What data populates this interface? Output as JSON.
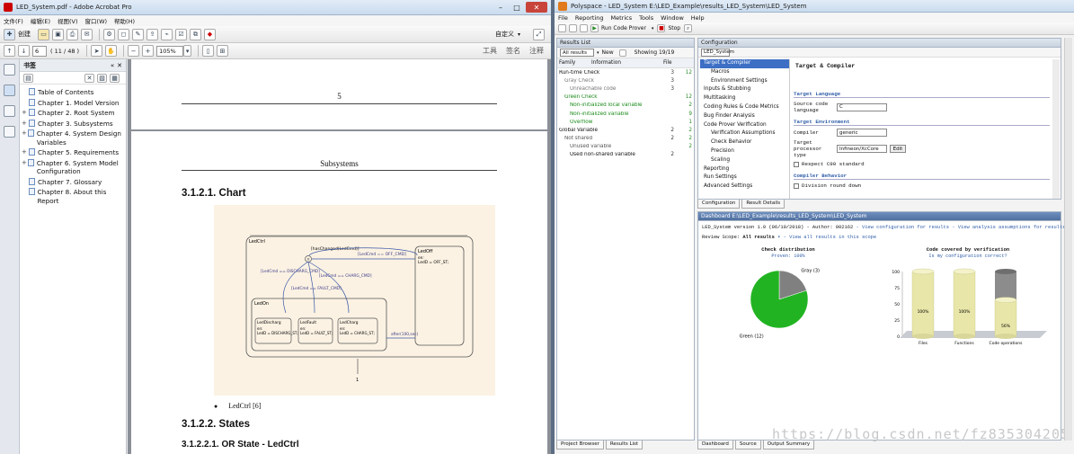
{
  "acrobat": {
    "title": "LED_System.pdf - Adobe Acrobat Pro",
    "menu": [
      "文件(F)",
      "编辑(E)",
      "视图(V)",
      "窗口(W)",
      "帮助(H)"
    ],
    "create_label": "创建",
    "customize_label": "自定义",
    "page_input": "6",
    "page_count": "( 11 / 48 )",
    "zoom": "105%",
    "right_tools": [
      "工具",
      "签名",
      "注释"
    ],
    "bookmarks_title": "书签",
    "bookmarks": [
      {
        "label": "Table of Contents",
        "expand": ""
      },
      {
        "label": "Chapter 1. Model Version",
        "expand": ""
      },
      {
        "label": "Chapter 2. Root System",
        "expand": "+"
      },
      {
        "label": "Chapter 3. Subsystems",
        "expand": "+"
      },
      {
        "label": "Chapter 4. System Design Variables",
        "expand": "+"
      },
      {
        "label": "Chapter 5. Requirements",
        "expand": "+"
      },
      {
        "label": "Chapter 6. System Model Configuration",
        "expand": "+"
      },
      {
        "label": "Chapter 7. Glossary",
        "expand": ""
      },
      {
        "label": "Chapter 8. About this Report",
        "expand": ""
      }
    ],
    "doc": {
      "page_number": "5",
      "running_header": "Subsystems",
      "h_chart": "3.1.2.1. Chart",
      "bullet_text": "LedCtrl [6]",
      "h_states": "3.1.2.2. States",
      "h_or_state": "3.1.2.2.1. OR State - LedCtrl"
    },
    "diagram": {
      "outer": "LedCtrl",
      "top_event": "[hasChanged(LedCmd)]",
      "to_off": "[LedCmd == OFF_CMD]",
      "off_state": "LedOff",
      "off_entry": "en:\nLedD = OFF_ST;",
      "disch": "[LedCmd == DISCHARG_CMD]",
      "charg": "[LedCmd == CHARG_CMD]",
      "fault": "[LedCmd == FAULT_CMD]",
      "on_state": "LedOn",
      "sub1": "LedDischarg",
      "sub1_entry": "en:\nLedD = DISCHARG_ST;",
      "sub2": "LedFault",
      "sub2_entry": "en:\nLedD = FAULT_ST;",
      "sub3": "LedCharg",
      "sub3_entry": "en:\nLedD = CHARG_ST;",
      "after": "after(100,sec)",
      "default_num": "1"
    }
  },
  "polyspace": {
    "title": "Polyspace - LED_System E:\\LED_Example\\results_LED_System\\LED_System",
    "menu": [
      "File",
      "Reporting",
      "Metrics",
      "Tools",
      "Window",
      "Help"
    ],
    "run_label": "Run Code Prover",
    "stop_label": "Stop",
    "results": {
      "title": "Results List",
      "filter": "All results",
      "new_label": "New",
      "showing": "Showing 19/19",
      "col_family": "Family",
      "col_info": "Information",
      "col_file": "File",
      "rows": [
        {
          "label": "Run-time Check",
          "indent": 0,
          "a": "3",
          "b": "12",
          "color": "#111"
        },
        {
          "label": "Gray Check",
          "indent": 1,
          "a": "3",
          "b": "",
          "color": "#777"
        },
        {
          "label": "Unreachable code",
          "indent": 2,
          "a": "3",
          "b": "",
          "color": "#777"
        },
        {
          "label": "Green Check",
          "indent": 1,
          "a": "",
          "b": "12",
          "color": "#1a8a1a"
        },
        {
          "label": "Non-initialized local variable",
          "indent": 2,
          "a": "",
          "b": "2",
          "color": "#1a8a1a"
        },
        {
          "label": "Non-initialized variable",
          "indent": 2,
          "a": "",
          "b": "9",
          "color": "#1a8a1a"
        },
        {
          "label": "Overflow",
          "indent": 2,
          "a": "",
          "b": "1",
          "color": "#1a8a1a"
        },
        {
          "label": "Global Variable",
          "indent": 0,
          "a": "2",
          "b": "2",
          "color": "#111"
        },
        {
          "label": "Not shared",
          "indent": 1,
          "a": "2",
          "b": "2",
          "color": "#555"
        },
        {
          "label": "Unused variable",
          "indent": 2,
          "a": "",
          "b": "2",
          "color": "#555"
        },
        {
          "label": "Used non-shared variable",
          "indent": 2,
          "a": "2",
          "b": "",
          "color": "#111"
        }
      ]
    },
    "config": {
      "title": "Configuration",
      "project": "LED_System",
      "tree": [
        {
          "label": "Target & Compiler",
          "indent": 0,
          "selected": true
        },
        {
          "label": "Macros",
          "indent": 1
        },
        {
          "label": "Environment Settings",
          "indent": 1
        },
        {
          "label": "Inputs & Stubbing",
          "indent": 0
        },
        {
          "label": "Multitasking",
          "indent": 0
        },
        {
          "label": "Coding Rules & Code Metrics",
          "indent": 0
        },
        {
          "label": "Bug Finder Analysis",
          "indent": 0
        },
        {
          "label": "Code Prover Verification",
          "indent": 0
        },
        {
          "label": "Verification Assumptions",
          "indent": 1
        },
        {
          "label": "Check Behavior",
          "indent": 1
        },
        {
          "label": "Precision",
          "indent": 1
        },
        {
          "label": "Scaling",
          "indent": 1
        },
        {
          "label": "Reporting",
          "indent": 0
        },
        {
          "label": "Run Settings",
          "indent": 0
        },
        {
          "label": "Advanced Settings",
          "indent": 0
        }
      ],
      "heading": "Target & Compiler",
      "sec_language": "Target Language",
      "lbl_source_lang": "Source code language",
      "val_source_lang": "C",
      "sec_env": "Target Environment",
      "lbl_compiler": "Compiler",
      "val_compiler": "generic",
      "lbl_processor": "Target processor type",
      "val_processor": "Infineon/XcCore",
      "edit_label": "Edit",
      "respect_label": "Respect C90 standard",
      "sec_behavior": "Compiler Behavior",
      "division_label": "Division round down",
      "tabs": [
        "Configuration",
        "Result Details"
      ]
    },
    "dashboard": {
      "title": "Dashboard E:\\LED_Example\\results_LED_System\\LED_System",
      "info_line": "LED_System version 1.0 (06/10/2018) - Author: 002162",
      "view_config": "View configuration for results",
      "view_assumptions": "View analysis assumptions for results",
      "scope_label": "Review Scope:",
      "scope_value": "All results",
      "scope_link": "View all results in this scope",
      "pie_title": "Check distribution",
      "pie_subtitle": "Proven: 100%",
      "bar_title": "Code covered by verification",
      "bar_subtitle": "Is my configuration correct?",
      "tabs": [
        "Dashboard",
        "Source",
        "Output Summary"
      ]
    },
    "bottom_tabs": [
      "Project Browser",
      "Results List"
    ]
  },
  "chart_data": [
    {
      "type": "pie",
      "title": "Check distribution",
      "categories": [
        "Green (12)",
        "Gray (3)"
      ],
      "values": [
        12,
        3
      ],
      "colors": [
        "#22b322",
        "#808080"
      ]
    },
    {
      "type": "bar",
      "title": "Code covered by verification",
      "categories": [
        "Files",
        "Functions",
        "Code operations"
      ],
      "values": [
        100,
        100,
        56
      ],
      "data_labels": [
        "100%",
        "100%",
        "56%"
      ],
      "ylim": [
        0,
        100
      ],
      "yticks": [
        "0",
        "25",
        "50",
        "75",
        "100"
      ],
      "grid": false
    }
  ],
  "watermark": "https://blog.csdn.net/fz835304205"
}
